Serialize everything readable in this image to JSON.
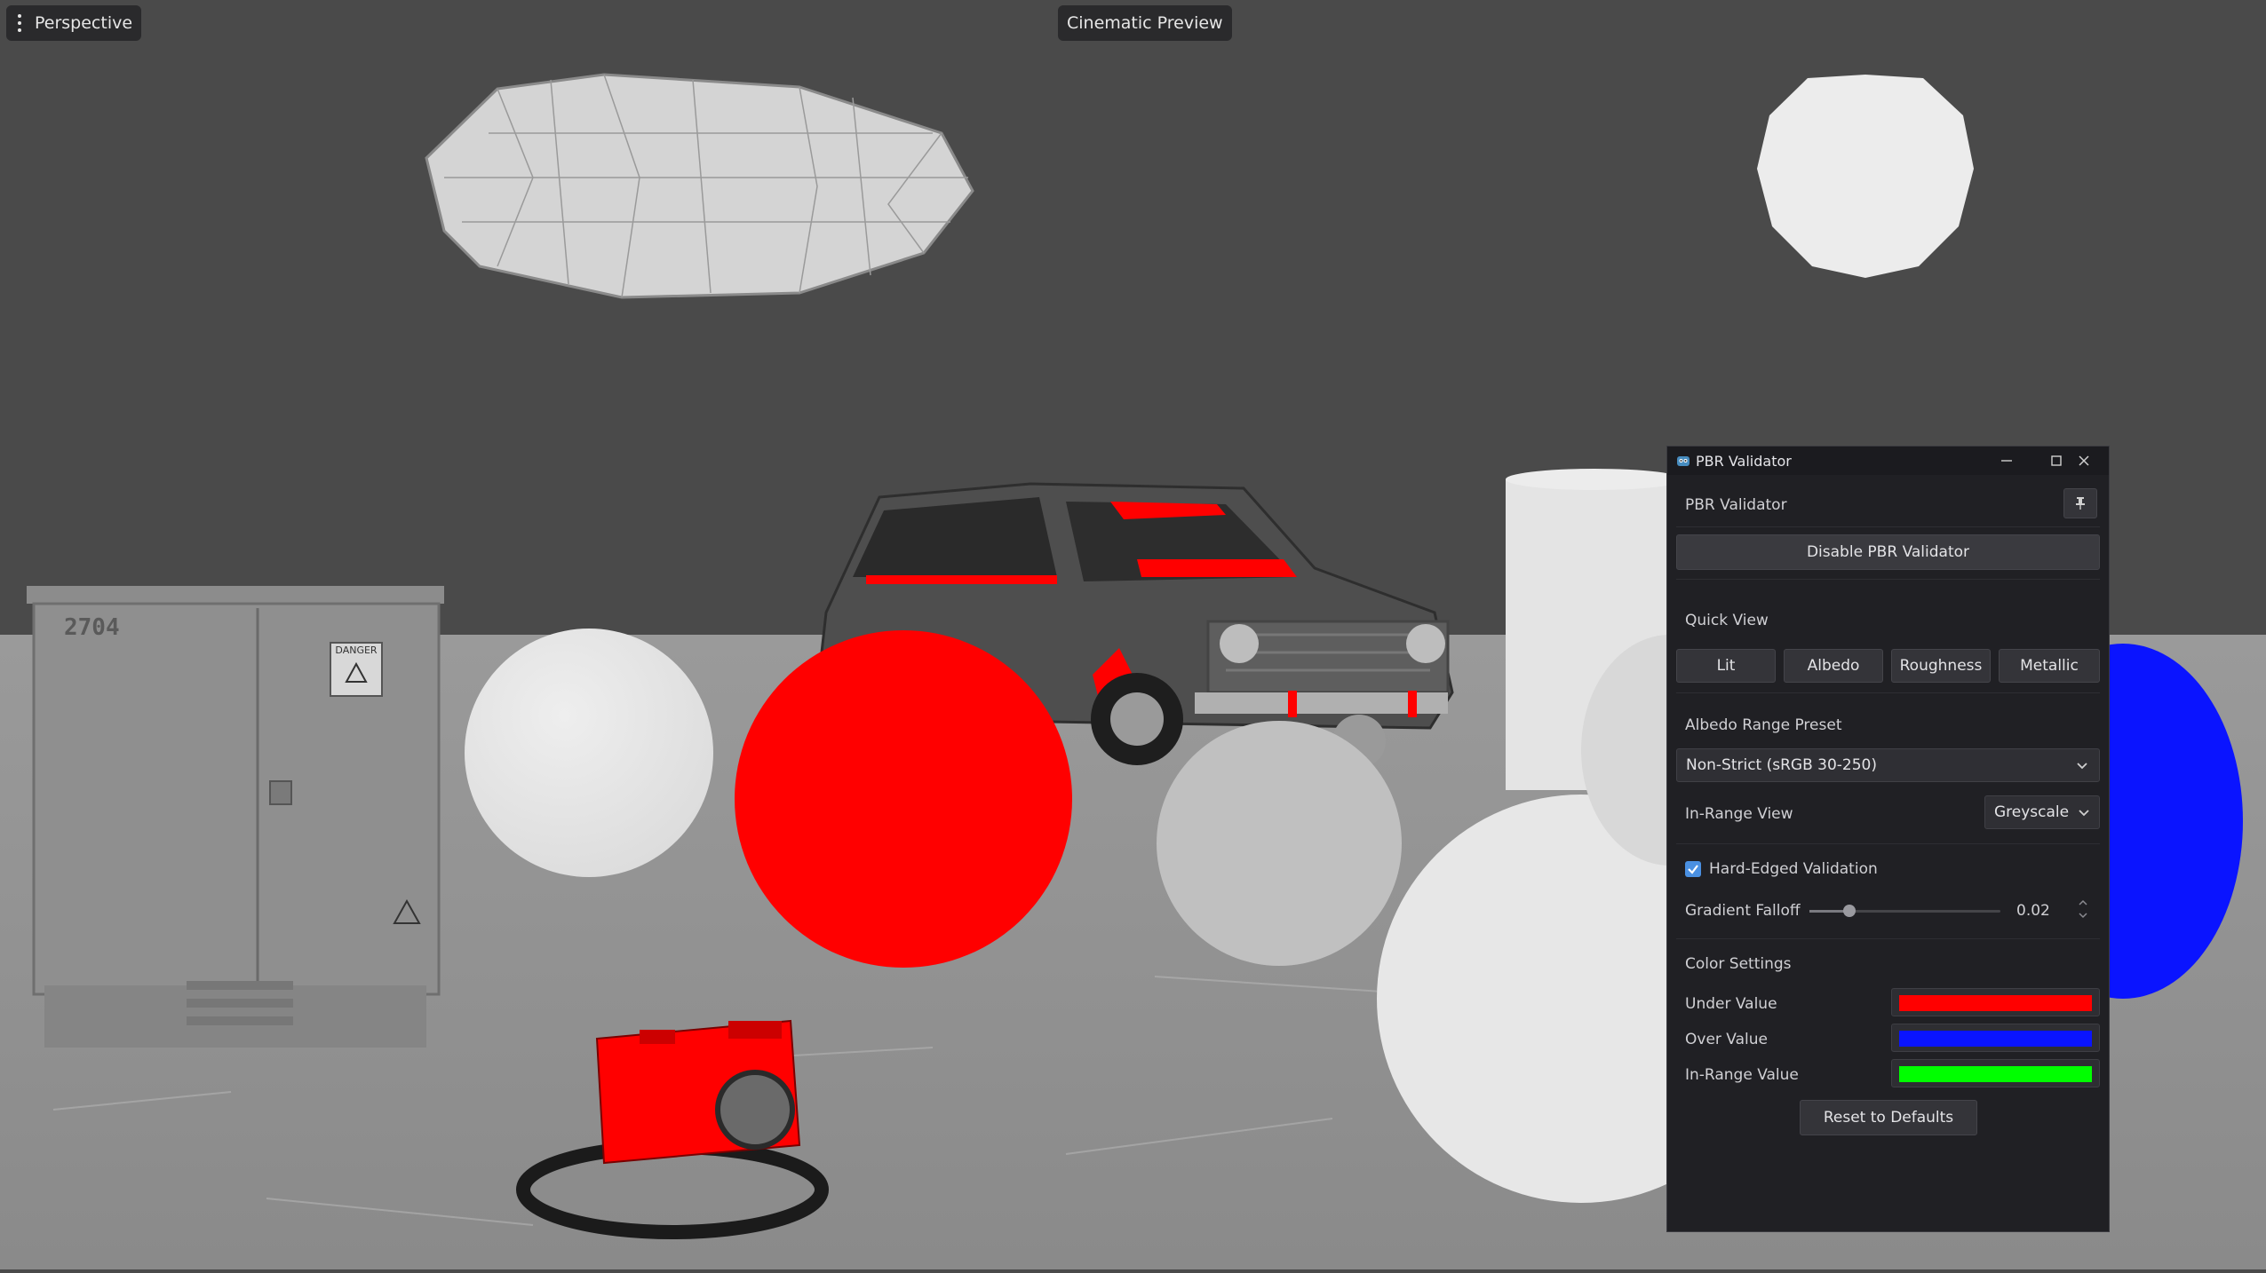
{
  "viewport": {
    "perspective_label": "Perspective",
    "cinematic_label": "Cinematic Preview",
    "box_number": "2704",
    "box_sign": "DANGER"
  },
  "window": {
    "title": "PBR Validator",
    "panel_title": "PBR Validator",
    "disable_label": "Disable PBR Validator",
    "quick_view_title": "Quick View",
    "quick_view_buttons": [
      "Lit",
      "Albedo",
      "Roughness",
      "Metallic"
    ],
    "albedo_preset_title": "Albedo Range Preset",
    "albedo_preset_value": "Non-Strict (sRGB 30-250)",
    "in_range_view_label": "In-Range View",
    "in_range_view_value": "Greyscale",
    "hard_edged_label": "Hard-Edged Validation",
    "hard_edged_checked": true,
    "gradient_falloff_label": "Gradient Falloff",
    "gradient_falloff_value": "0.02",
    "color_settings_title": "Color Settings",
    "under_label": "Under Value",
    "over_label": "Over Value",
    "inrange_label": "In-Range Value",
    "reset_label": "Reset to Defaults",
    "colors": {
      "under": "#ff0000",
      "over": "#0a14ff",
      "inrange": "#00ff00",
      "accent": "#4a90e2"
    }
  }
}
